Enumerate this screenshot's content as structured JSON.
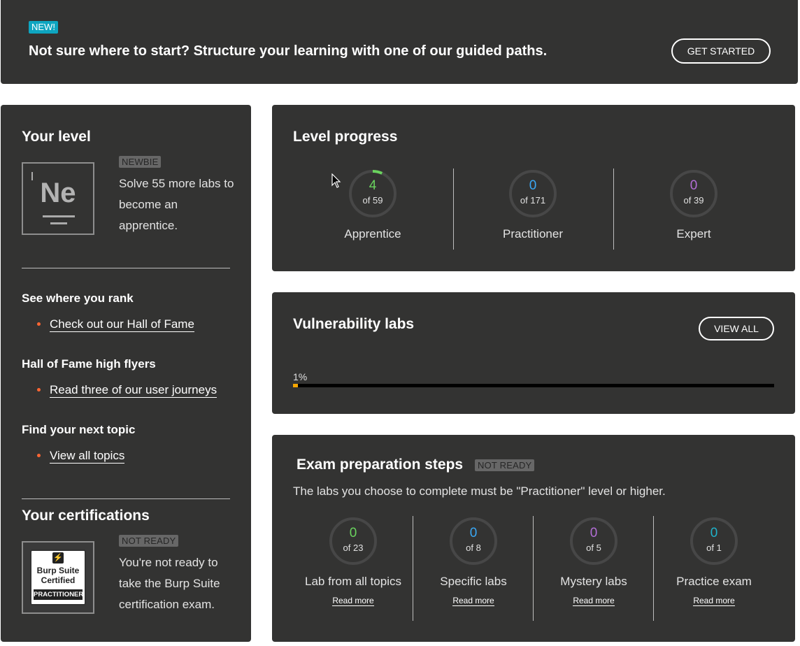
{
  "colors": {
    "card_bg": "#333332",
    "new_badge": "#0ea5c0",
    "apprentice": "#6ad35e",
    "practitioner": "#3aa8f5",
    "expert": "#b36ed6",
    "practice_exam": "#1fb2c9",
    "bullet": "#ff6633",
    "progress_fill": "#f7a600"
  },
  "banner": {
    "badge": "NEW!",
    "title": "Not sure where to start? Structure your learning with one of our guided paths.",
    "button": "GET STARTED"
  },
  "your_level": {
    "heading": "Your level",
    "symbol": "Ne",
    "badge": "NEWBIE",
    "description": "Solve 55 more labs to become an apprentice.",
    "sections": [
      {
        "title": "See where you rank",
        "link": "Check out our Hall of Fame"
      },
      {
        "title": "Hall of Fame high flyers",
        "link": "Read three of our user journeys"
      },
      {
        "title": "Find your next topic",
        "link": "View all topics"
      }
    ]
  },
  "certifications": {
    "heading": "Your certifications",
    "badge": "NOT READY",
    "description": "You're not ready to take the Burp Suite certification exam.",
    "logo_text": "Burp Suite Certified",
    "logo_band": "PRACTITIONER"
  },
  "level_progress": {
    "heading": "Level progress",
    "items": [
      {
        "value": "4",
        "of": "of 59",
        "label": "Apprentice",
        "fraction": 0.068,
        "color_key": "apprentice"
      },
      {
        "value": "0",
        "of": "of 171",
        "label": "Practitioner",
        "fraction": 0,
        "color_key": "practitioner"
      },
      {
        "value": "0",
        "of": "of 39",
        "label": "Expert",
        "fraction": 0,
        "color_key": "expert"
      }
    ]
  },
  "vulnerability_labs": {
    "heading": "Vulnerability labs",
    "button": "VIEW ALL",
    "percent_text": "1%",
    "fraction": 0.01
  },
  "exam_prep": {
    "heading": "Exam preparation steps",
    "badge": "NOT READY",
    "description": "The labs you choose to complete must be \"Practitioner\" level or higher.",
    "read_more": "Read more",
    "items": [
      {
        "value": "0",
        "of": "of 23",
        "label": "Lab from all topics",
        "color_key": "apprentice"
      },
      {
        "value": "0",
        "of": "of 8",
        "label": "Specific labs",
        "color_key": "practitioner"
      },
      {
        "value": "0",
        "of": "of 5",
        "label": "Mystery labs",
        "color_key": "expert"
      },
      {
        "value": "0",
        "of": "of 1",
        "label": "Practice exam",
        "color_key": "practice_exam"
      }
    ]
  }
}
